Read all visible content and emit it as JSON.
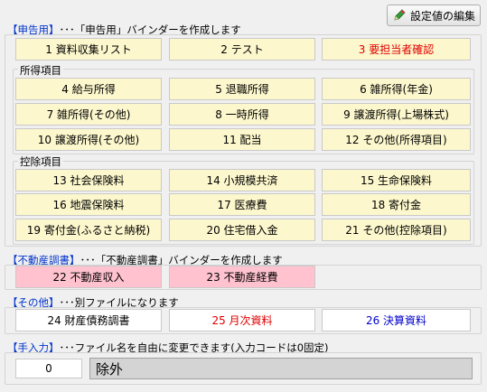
{
  "toolbar": {
    "edit_settings_label": "設定値の編集",
    "edit_icon": "pencil-icon"
  },
  "sections": {
    "tax": {
      "title_tag": "【申告用】",
      "title_text": "･･･「申告用」バインダーを作成します",
      "top_buttons": [
        "1 資料収集リスト",
        "2 テスト",
        "3 要担当者確認"
      ],
      "income_label": "所得項目",
      "income_buttons": [
        "4 給与所得",
        "5 退職所得",
        "6 雑所得(年金)",
        "7 雑所得(その他)",
        "8 一時所得",
        "9 譲渡所得(上場株式)",
        "10 譲渡所得(その他)",
        "11 配当",
        "12 その他(所得項目)"
      ],
      "deduction_label": "控除項目",
      "deduction_buttons": [
        "13 社会保険料",
        "14 小規模共済",
        "15 生命保険料",
        "16 地震保険料",
        "17 医療費",
        "18 寄付金",
        "19 寄付金(ふるさと納税)",
        "20 住宅借入金",
        "21 その他(控除項目)"
      ]
    },
    "realestate": {
      "title_tag": "【不動産調書】",
      "title_text": "･･･「不動産調書」バインダーを作成します",
      "buttons": [
        "22 不動産収入",
        "23 不動産経費"
      ]
    },
    "other": {
      "title_tag": "【その他】",
      "title_text": "･･･別ファイルになります",
      "buttons": [
        "24 財産債務調書",
        "25 月次資料",
        "26 決算資料"
      ]
    },
    "manual": {
      "title_tag": "【手入力】",
      "title_text": "･･･ファイル名を自由に変更できます(入力コードは0固定)",
      "code_value": "0",
      "name_value": "除外"
    }
  },
  "colors": {
    "button_bg": "#fcf7cc",
    "pink_bg": "#ffc2ce",
    "red_text": "#e00000",
    "blue_text": "#0000cc",
    "title_tag": "#0033cc"
  }
}
